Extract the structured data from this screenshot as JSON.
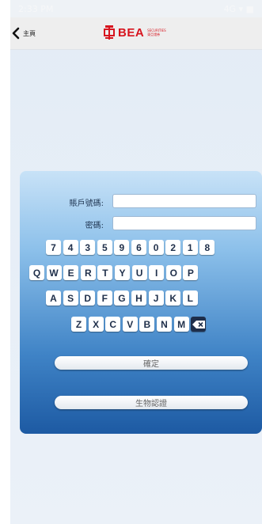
{
  "status_bar": {
    "time": "2:33 PM",
    "icons": "4G ▾ ■"
  },
  "nav": {
    "back_label": "主頁",
    "logo_word": "BEA",
    "logo_sub_en": "SECURITIES",
    "logo_sub_zh": "東亞證券"
  },
  "form": {
    "account_label": "賬戶號碼:",
    "account_value": "",
    "password_label": "密碼:",
    "password_value": ""
  },
  "keypad": {
    "digits": [
      "7",
      "4",
      "3",
      "5",
      "9",
      "6",
      "0",
      "2",
      "1",
      "8"
    ],
    "row1": [
      "Q",
      "W",
      "E",
      "R",
      "T",
      "Y",
      "U",
      "I",
      "O",
      "P"
    ],
    "row2": [
      "A",
      "S",
      "D",
      "F",
      "G",
      "H",
      "J",
      "K",
      "L"
    ],
    "row3": [
      "Z",
      "X",
      "C",
      "V",
      "B",
      "N",
      "M"
    ],
    "delete_icon": "backspace-icon"
  },
  "buttons": {
    "confirm": "確定",
    "biometric": "生物認證"
  },
  "colors": {
    "brand_red": "#d7141e",
    "panel_top": "#c8e2f7",
    "panel_bottom": "#1d5aa3"
  }
}
